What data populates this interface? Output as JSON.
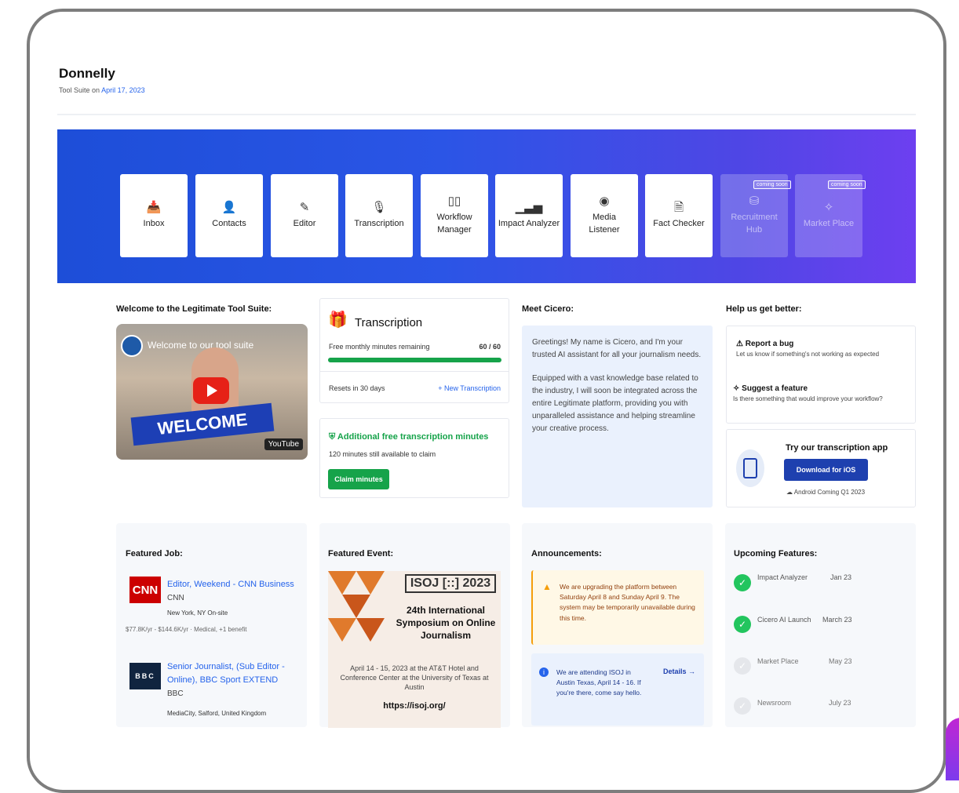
{
  "header": {
    "name": "Donnelly",
    "sub_prefix": "Tool Suite on",
    "sub_date": "April 17, 2023"
  },
  "tools": [
    {
      "label": "Inbox",
      "icon": "📥"
    },
    {
      "label": "Contacts",
      "icon": "👤"
    },
    {
      "label": "Editor",
      "icon": "✎"
    },
    {
      "label": "Transcription",
      "icon": "🎙"
    },
    {
      "label": "Workflow Manager",
      "icon": "▯▯"
    },
    {
      "label": "Impact Analyzer",
      "icon": "▁▃▅"
    },
    {
      "label": "Media Listener",
      "icon": "◉"
    },
    {
      "label": "Fact Checker",
      "icon": "🗎"
    },
    {
      "label": "Recruitment Hub",
      "icon": "⛁",
      "badge": "coming soon"
    },
    {
      "label": "Market Place",
      "icon": "✧",
      "badge": "coming soon"
    }
  ],
  "welcome": {
    "title": "Welcome to the Legitimate Tool Suite:",
    "video_title": "Welcome to our tool suite",
    "video_banner": "WELCOME",
    "video_brand": "YouTube"
  },
  "transcription": {
    "title": "Transcription",
    "minutes_label": "Free monthly minutes remaining",
    "minutes_value": "60 / 60",
    "minutes_fraction": 1.0,
    "resets": "Resets in 30 days",
    "new_link": "+ New Transcription",
    "extra_title": "Additional free transcription minutes",
    "extra_desc": "120 minutes still available to claim",
    "claim_button": "Claim minutes"
  },
  "cicero": {
    "title": "Meet Cicero:",
    "p1": "Greetings! My name is Cicero, and I'm your trusted AI assistant for all your journalism needs.",
    "p2": "Equipped with a vast knowledge base related to the industry, I will soon be integrated across the entire Legitimate platform, providing you with unparalleled assistance and helping streamline your creative process."
  },
  "help": {
    "title": "Help us get better:",
    "bug_title": "Report a bug",
    "bug_desc": "Let us know if something's not working as expected",
    "feature_title": "Suggest a feature",
    "feature_desc": "Is there something that would improve your workflow?",
    "app_title": "Try our transcription app",
    "ios_button": "Download for iOS",
    "android_note": "Android Coming Q1 2023"
  },
  "featured_job": {
    "title": "Featured Job:",
    "jobs": [
      {
        "logo": "CNN",
        "role": "Editor, Weekend - CNN Business",
        "company": "CNN",
        "location": "New York, NY On-site",
        "pay": "$77.8K/yr - $144.6K/yr · Medical, +1 benefit"
      },
      {
        "logo": "BBC",
        "role": "Senior Journalist, (Sub Editor - Online), BBC Sport EXTEND",
        "company": "BBC",
        "location": "MediaCity, Salford, United Kingdom",
        "pay": ""
      }
    ]
  },
  "featured_event": {
    "title": "Featured Event:",
    "logo": "ISOJ [::] 2023",
    "name": "24th International Symposium on Online Journalism",
    "details": "April 14 - 15, 2023 at the AT&T Hotel and Conference Center at the University of Texas at Austin",
    "url": "https://isoj.org/"
  },
  "announcements": {
    "title": "Announcements:",
    "a1": "We are upgrading the platform between Saturday April 8 and Sunday April 9. The system may be temporarily unavailable during this time.",
    "a2": "We are attending ISOJ in Austin Texas, April 14 - 16. If you're there, come say hello.",
    "a2_link": "Details →"
  },
  "upcoming": {
    "title": "Upcoming Features:",
    "items": [
      {
        "name": "Impact Analyzer",
        "date": "Jan 23",
        "done": true
      },
      {
        "name": "Cicero AI Launch",
        "date": "March 23",
        "done": true
      },
      {
        "name": "Market Place",
        "date": "May 23",
        "done": false
      },
      {
        "name": "Newsroom",
        "date": "July 23",
        "done": false
      }
    ]
  },
  "colors": {
    "hero_start": "#1d4ed8",
    "hero_end": "#6d3ff0",
    "accent_green": "#16a34a",
    "accent_blue": "#1e40af"
  }
}
